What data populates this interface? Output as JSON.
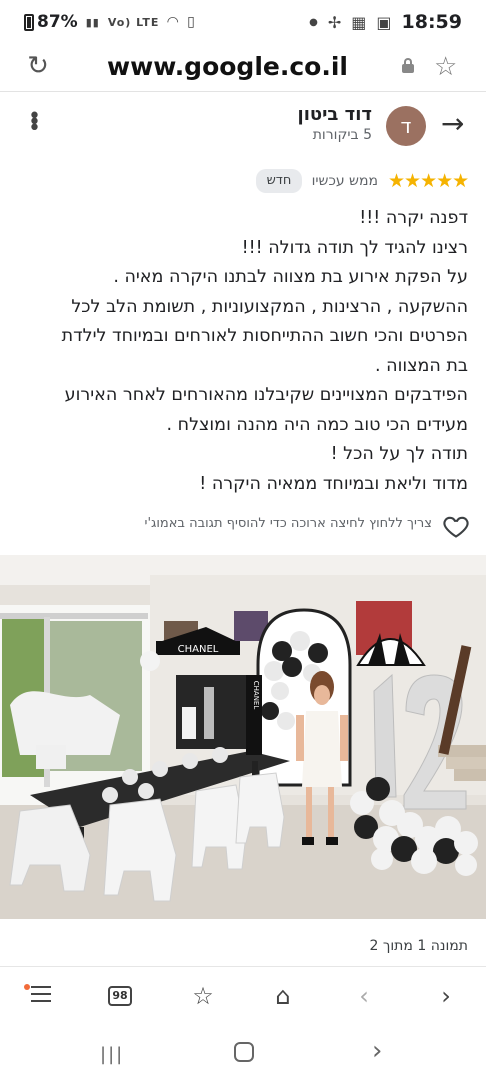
{
  "status_bar": {
    "battery": "87%",
    "network_indicator": "Vo) LTE",
    "time": "18:59"
  },
  "browser": {
    "url": "www.google.co.il"
  },
  "review": {
    "author": "דוד ביטון",
    "avatar_letter": "ד",
    "visits": "5 ביקורות",
    "rating": 5,
    "time": "ממש עכשיו",
    "badge": "חדש",
    "lines": [
      "דפנה יקרה !!!",
      "רצינו להגיד לך תודה גדולה !!!",
      "על הפקת אירוע בת מצווה לבתנו היקרה מאיה .",
      "ההשקעה , הרצינות , המקצועוניות , תשומת הלב לכל",
      "הפרטים והכי חשוב ההתייחסות לאורחים ובמיוחד לילדת",
      "בת המצווה .",
      "הפידבקים המצויינים שקיבלנו מהאורחים לאחר האירוע",
      "מעידים הכי טוב כמה היה מהנה ומוצלח .",
      "תודה לך על הכל !",
      "מדוד וליאת ובמיוחד ממאיה היקרה !"
    ],
    "response_hint": "צריך ללחוץ לחיצה ארוכה כדי להוסיף תגובה באמוג'י",
    "photo_caption": "תמונה 1 מתוך 2",
    "photo_text": {
      "chanel_sign": "CHANEL",
      "chanel_chair": "CHANEL",
      "balloon_number": "12"
    }
  },
  "bottom_nav": {
    "tabs_count": "98"
  },
  "colors": {
    "star": "#f5b301",
    "avatar": "#9b7161",
    "notification_dot": "#f26b3a"
  }
}
